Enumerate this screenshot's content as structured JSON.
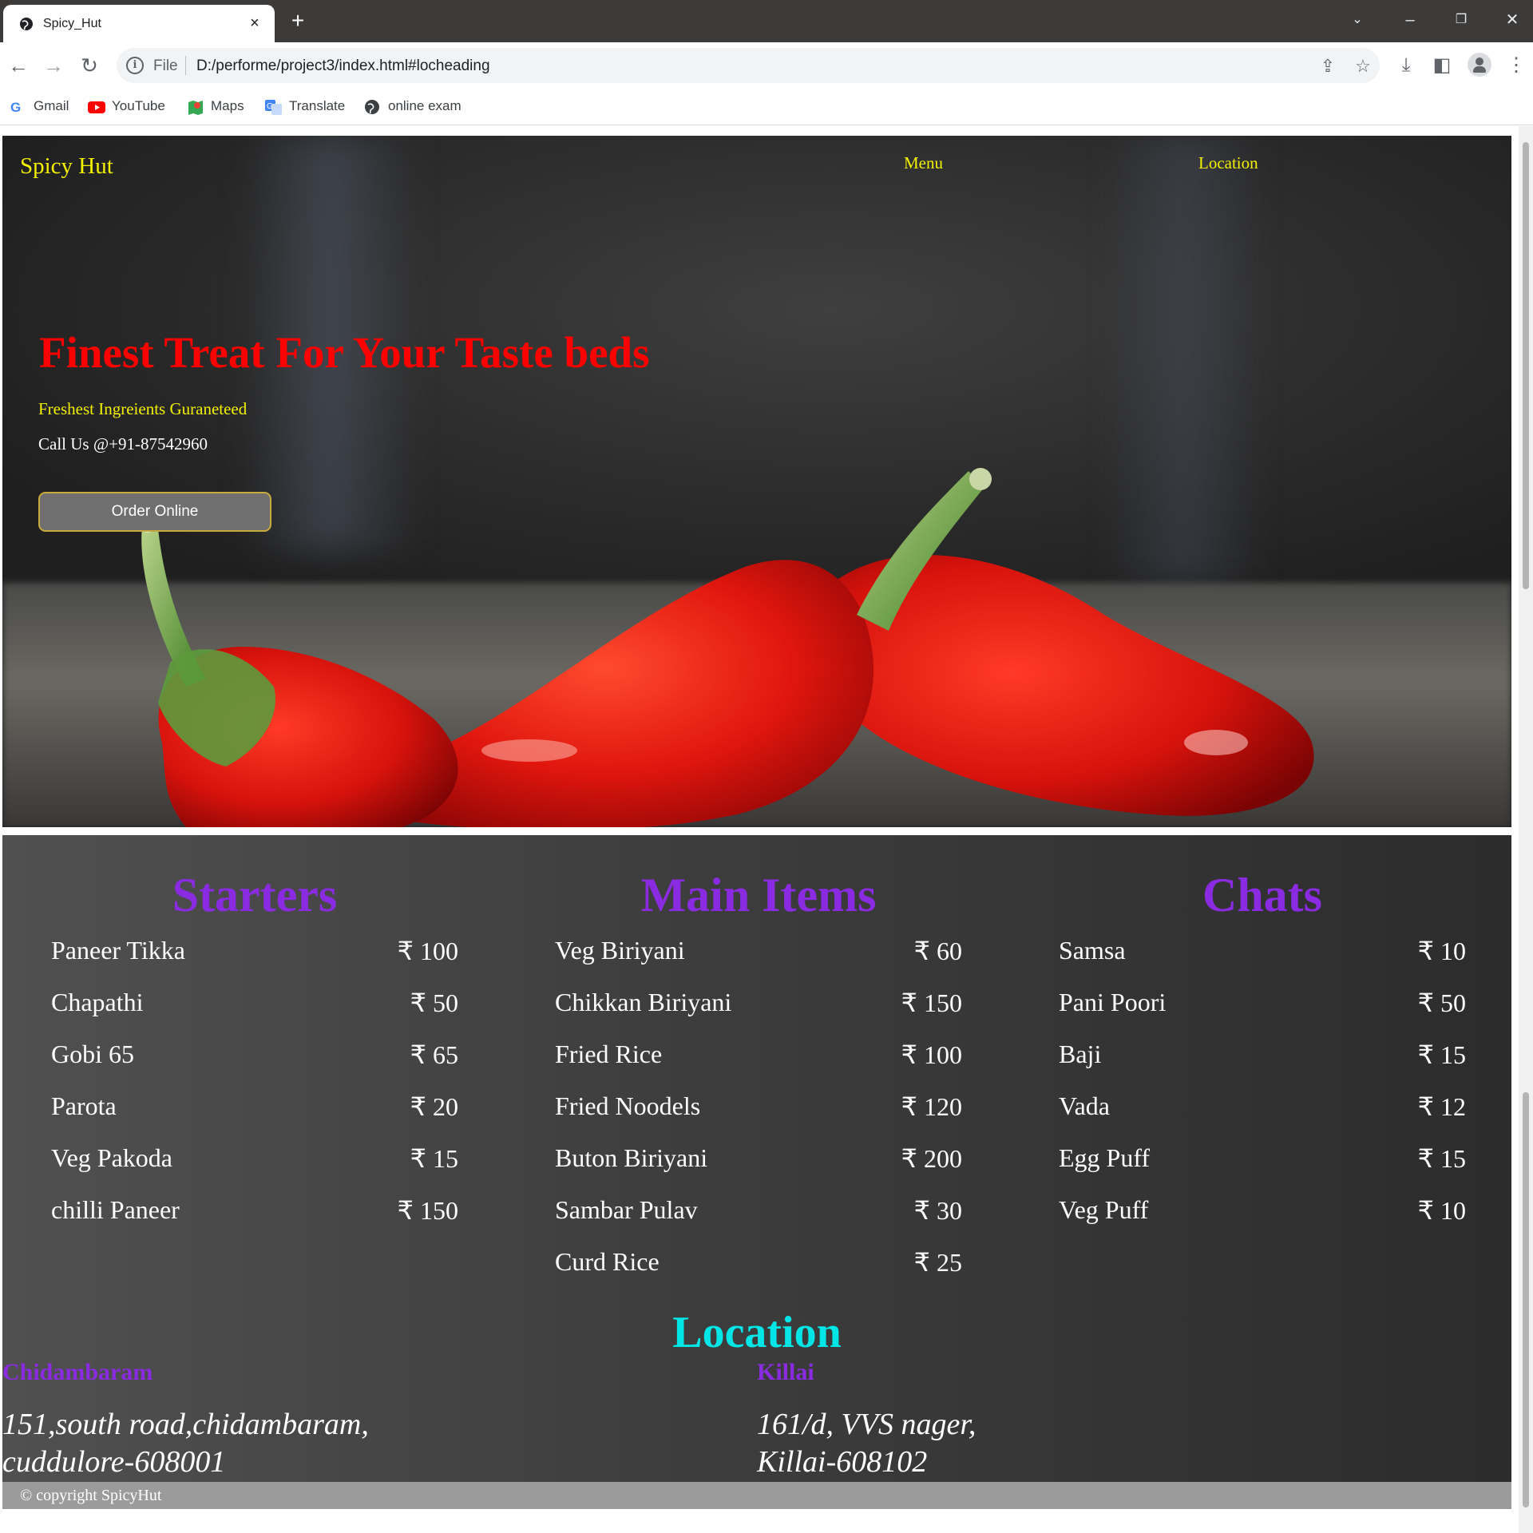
{
  "browser": {
    "tab_title": "Spicy_Hut",
    "tab_close": "×",
    "new_tab": "+",
    "omnibox_scheme": "File",
    "url": "D:/performe/project3/index.html#locheading",
    "bookmarks": [
      {
        "label": "Gmail",
        "icon": "gmail-icon"
      },
      {
        "label": "YouTube",
        "icon": "youtube-icon"
      },
      {
        "label": "Maps",
        "icon": "maps-icon"
      },
      {
        "label": "Translate",
        "icon": "translate-icon"
      },
      {
        "label": "online exam",
        "icon": "globe-icon"
      }
    ]
  },
  "nav": {
    "brand": "Spicy Hut",
    "links": [
      "Menu",
      "Location"
    ]
  },
  "hero": {
    "headline": "Finest Treat For Your Taste beds",
    "subline": "Freshest Ingreients Guraneteed",
    "call": "Call Us @+91-87542960",
    "order_button": "Order Online"
  },
  "menu": {
    "starters": {
      "title": "Starters",
      "items": [
        {
          "name": "Paneer Tikka",
          "price": "₹ 100"
        },
        {
          "name": "Chapathi",
          "price": "₹ 50"
        },
        {
          "name": "Gobi 65",
          "price": "₹ 65"
        },
        {
          "name": "Parota",
          "price": "₹ 20"
        },
        {
          "name": "Veg Pakoda",
          "price": "₹ 15"
        },
        {
          "name": "chilli Paneer",
          "price": "₹ 150"
        }
      ]
    },
    "main": {
      "title": "Main Items",
      "items": [
        {
          "name": "Veg Biriyani",
          "price": "₹ 60"
        },
        {
          "name": "Chikkan Biriyani",
          "price": "₹ 150"
        },
        {
          "name": "Fried Rice",
          "price": "₹ 100"
        },
        {
          "name": "Fried Noodels",
          "price": "₹ 120"
        },
        {
          "name": "Buton Biriyani",
          "price": "₹ 200"
        },
        {
          "name": "Sambar Pulav",
          "price": "₹ 30"
        },
        {
          "name": "Curd Rice",
          "price": "₹ 25"
        }
      ]
    },
    "chats": {
      "title": "Chats",
      "items": [
        {
          "name": "Samsa",
          "price": "₹ 10"
        },
        {
          "name": "Pani Poori",
          "price": "₹ 50"
        },
        {
          "name": "Baji",
          "price": "₹ 15"
        },
        {
          "name": "Vada",
          "price": "₹ 12"
        },
        {
          "name": "Egg Puff",
          "price": "₹ 15"
        },
        {
          "name": "Veg Puff",
          "price": "₹ 10"
        }
      ]
    }
  },
  "location": {
    "title": "Location",
    "branches": [
      {
        "name": "Chidambaram",
        "line1": "151,south road,chidambaram,",
        "line2": "cuddulore-608001"
      },
      {
        "name": "Killai",
        "line1": "161/d, VVS nager,",
        "line2": "Killai-608102"
      }
    ]
  },
  "footer": {
    "text": "© copyright SpicyHut"
  },
  "colors": {
    "brand_yellow": "#f3f100",
    "headline_red": "#ff0000",
    "section_purple": "#8a2be2",
    "location_cyan": "#00e5e5"
  }
}
